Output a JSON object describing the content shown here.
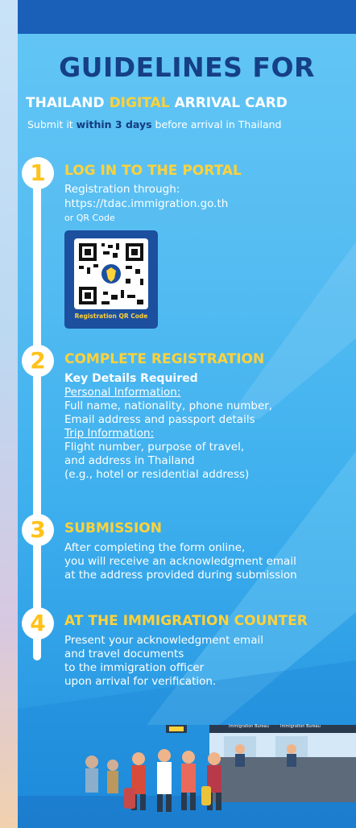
{
  "header": {
    "title": "GUIDELINES FOR",
    "subtitle_part1": "THAILAND ",
    "subtitle_digital": "DIGITAL",
    "subtitle_part2": " ARRIVAL CARD",
    "tagline_prefix": "Submit it ",
    "tagline_bold": "within 3 days",
    "tagline_suffix": " before arrival in Thailand"
  },
  "steps": [
    {
      "number": "1",
      "heading": "LOG IN TO THE PORTAL",
      "line1": "Registration through:",
      "line2": "https://tdac.immigration.go.th",
      "line3": "or QR Code",
      "qr_caption": "Registration QR Code"
    },
    {
      "number": "2",
      "heading": "COMPLETE REGISTRATION",
      "key_details": "Key Details Required",
      "personal_label": "Personal Information:",
      "personal_line1": "Full name, nationality, phone number,",
      "personal_line2": "Email address and passport details",
      "trip_label": "Trip Information:",
      "trip_line1": "Flight number, purpose of travel,",
      "trip_line2": "and address in Thailand",
      "trip_line3": "(e.g., hotel or residential address)"
    },
    {
      "number": "3",
      "heading": "SUBMISSION",
      "line1": "After completing the form online,",
      "line2": "you will receive an acknowledgment email",
      "line3": "at the address provided  during submission"
    },
    {
      "number": "4",
      "heading": "AT THE IMMIGRATION COUNTER",
      "line1": "Present your acknowledgment email",
      "line2": "and travel documents",
      "line3": "to the immigration officer",
      "line4": "upon arrival for verification."
    }
  ],
  "scene": {
    "sign1": "Immigration Bureau",
    "sign2": "Immigration Bureau"
  },
  "colors": {
    "accent_yellow": "#ffd23a",
    "navy": "#153f86",
    "sky": "#56bdf2"
  }
}
